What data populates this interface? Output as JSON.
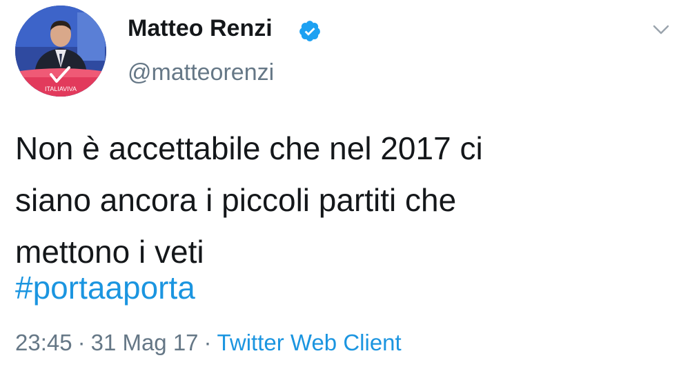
{
  "author": {
    "name": "Matteo Renzi",
    "handle": "@matteorenzi",
    "verified": true,
    "avatar_badge_text": "ITALIAVIVA"
  },
  "tweet": {
    "text_lines": [
      "Non è accettabile che nel 2017 ci",
      "siano ancora i piccoli partiti che",
      "mettono i veti"
    ],
    "hashtag": "#portaaporta",
    "time": "23:45",
    "date": "31 Mag 17",
    "separator": "·",
    "client": "Twitter Web Client"
  },
  "icons": {
    "verified": "verified-badge-icon",
    "menu": "chevron-down-icon"
  },
  "colors": {
    "link": "#1b95e0",
    "muted": "#657786",
    "text": "#14171a",
    "verified": "#1da1f2"
  }
}
